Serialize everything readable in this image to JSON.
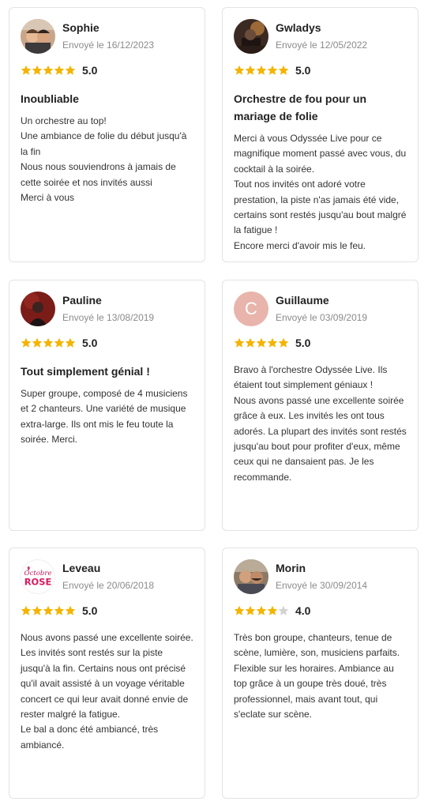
{
  "colors": {
    "star_filled": "#f4b400",
    "star_empty": "#d3d3d3",
    "letter_avatar_bg": "#e8b4ab"
  },
  "reviews": [
    {
      "name": "Sophie",
      "date": "Envoyé le 16/12/2023",
      "stars": 5,
      "score": "5.0",
      "title": "Inoubliable",
      "body": "Un orchestre au top!\nUne ambiance de folie du début jusqu'à la fin\nNous nous souviendrons à jamais de cette soirée et nos invités aussi\nMerci à vous"
    },
    {
      "name": "Gwladys",
      "date": "Envoyé le 12/05/2022",
      "stars": 5,
      "score": "5.0",
      "title": "Orchestre de fou pour un mariage de folie",
      "body": "Merci à vous Odyssée Live pour ce magnifique moment passé avec vous, du cocktail à la soirée.\nTout nos invités ont adoré votre prestation, la piste n'as jamais été vide, certains sont restés jusqu'au bout malgré la fatigue !\nEncore merci d'avoir mis le feu."
    },
    {
      "name": "Pauline",
      "date": "Envoyé le 13/08/2019",
      "stars": 5,
      "score": "5.0",
      "title": "Tout simplement génial !",
      "body": "Super groupe, composé de 4 musiciens et 2 chanteurs. Une variété de musique extra-large. Ils ont mis le feu toute la soirée. Merci."
    },
    {
      "name": "Guillaume",
      "avatar_letter": "C",
      "date": "Envoyé le 03/09/2019",
      "stars": 5,
      "score": "5.0",
      "body": "Bravo à l'orchestre Odyssée Live. Ils étaient tout simplement géniaux !\nNous avons passé une excellente soirée grâce à eux. Les invités les ont tous adorés. La plupart des invités sont restés jusqu'au bout pour profiter d'eux, même ceux qui ne dansaient pas. Je les recommande."
    },
    {
      "name": "Leveau",
      "avatar_text_1": "Octobre",
      "avatar_text_2": "ROSE",
      "date": "Envoyé le 20/06/2018",
      "stars": 5,
      "score": "5.0",
      "body": "Nous avons passé une excellente soirée.\nLes invités sont restés sur la piste jusqu'à la fin. Certains nous ont précisé qu'il avait assisté à un voyage véritable concert ce qui leur avait donné envie de rester malgré la fatigue.\nLe bal a donc été ambiancé, très ambiancé."
    },
    {
      "name": "Morin",
      "date": "Envoyé le 30/09/2014",
      "stars": 4,
      "score": "4.0",
      "body": "Très bon groupe, chanteurs, tenue de scène, lumière, son, musiciens parfaits. Flexible sur les horaires. Ambiance au top grâce à un goupe très doué, très professionnel, mais avant tout, qui s'eclate sur scène."
    }
  ]
}
